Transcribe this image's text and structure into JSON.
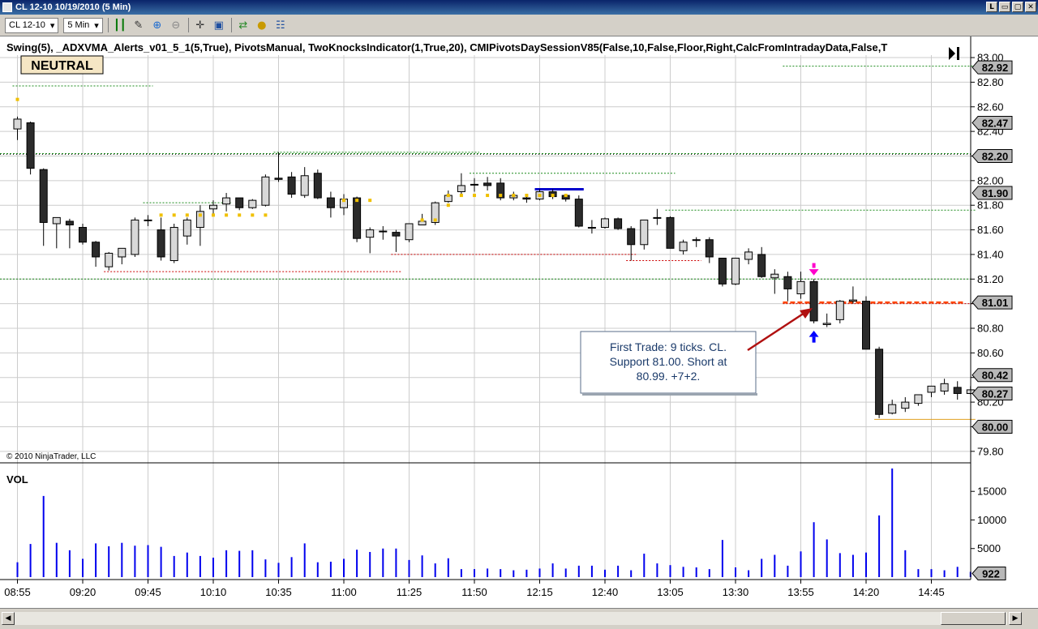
{
  "window": {
    "title": "CL 12-10  10/19/2010 (5 Min)",
    "buttons": [
      "L",
      "▭",
      "▢",
      "✕"
    ]
  },
  "toolbar": {
    "instrument": "CL 12-10",
    "interval": "5 Min"
  },
  "indicators_line": "Swing(5),  _ADXVMA_Alerts_v01_5_1(5,True),  PivotsManual,  TwoKnocksIndicator(1,True,20),  CMIPivotsDaySessionV85(False,10,False,Floor,Right,CalcFromIntradayData,False,T",
  "status_badge": "NEUTRAL",
  "copyright": "© 2010 NinjaTrader, LLC",
  "volume_label": "VOL",
  "annotation": "First Trade: 9 ticks. CL. Support 81.00. Short at 80.99. +7+2.",
  "colors": {
    "up_fill": "#d8d8d8",
    "down_fill": "#2b2b2b",
    "volume": "#0000ee",
    "grid": "#cccccc",
    "entry_line": "#ff4500",
    "arrow": "#b01010",
    "green_level": "#1a8a1a",
    "red_level": "#cc0000",
    "long_arrow": "#0000ff",
    "short_arrow": "#ff00cc"
  },
  "chart_data": {
    "type": "candlestick",
    "title": "CL 12-10  10/19/2010 (5 Min)",
    "price_axis": {
      "ylim": [
        79.7,
        83.02
      ],
      "ticks": [
        "83.00",
        "82.80",
        "82.60",
        "82.40",
        "82.20",
        "82.00",
        "81.80",
        "81.60",
        "81.40",
        "81.20",
        "81.00",
        "80.80",
        "80.60",
        "80.40",
        "80.20",
        "80.00",
        "79.80"
      ]
    },
    "price_badges": [
      {
        "label": "82.92",
        "value": 82.92
      },
      {
        "label": "82.47",
        "value": 82.47
      },
      {
        "label": "82.20",
        "value": 82.2
      },
      {
        "label": "81.90",
        "value": 81.9
      },
      {
        "label": "81.01",
        "value": 81.01
      },
      {
        "label": "80.42",
        "value": 80.42
      },
      {
        "label": "80.27",
        "value": 80.27
      },
      {
        "label": "80.00",
        "value": 80.0
      }
    ],
    "time_ticks": [
      "08:55",
      "09:20",
      "09:45",
      "10:10",
      "10:35",
      "11:00",
      "11:25",
      "11:50",
      "12:15",
      "12:40",
      "13:05",
      "13:30",
      "13:55",
      "14:20",
      "14:45"
    ],
    "bar_count": 74,
    "candles": [
      [
        82.42,
        82.52,
        82.33,
        82.5
      ],
      [
        82.47,
        82.48,
        82.05,
        82.1
      ],
      [
        82.09,
        82.1,
        81.47,
        81.66
      ],
      [
        81.65,
        81.7,
        81.45,
        81.7
      ],
      [
        81.67,
        81.69,
        81.45,
        81.64
      ],
      [
        81.62,
        81.65,
        81.48,
        81.5
      ],
      [
        81.5,
        81.51,
        81.3,
        81.38
      ],
      [
        81.3,
        81.42,
        81.27,
        81.41
      ],
      [
        81.38,
        81.45,
        81.32,
        81.45
      ],
      [
        81.4,
        81.7,
        81.38,
        81.68
      ],
      [
        81.68,
        81.72,
        81.63,
        81.68
      ],
      [
        81.6,
        81.7,
        81.35,
        81.38
      ],
      [
        81.35,
        81.65,
        81.33,
        81.62
      ],
      [
        81.55,
        81.7,
        81.48,
        81.68
      ],
      [
        81.62,
        81.8,
        81.47,
        81.75
      ],
      [
        81.77,
        81.84,
        81.73,
        81.8
      ],
      [
        81.81,
        81.9,
        81.75,
        81.86
      ],
      [
        81.86,
        81.86,
        81.76,
        81.78
      ],
      [
        81.78,
        81.85,
        81.77,
        81.84
      ],
      [
        81.8,
        82.05,
        81.79,
        82.03
      ],
      [
        82.02,
        82.23,
        81.99,
        82.01
      ],
      [
        82.03,
        82.07,
        81.86,
        81.89
      ],
      [
        81.88,
        82.11,
        81.86,
        82.04
      ],
      [
        82.06,
        82.09,
        81.85,
        81.86
      ],
      [
        81.86,
        81.91,
        81.7,
        81.78
      ],
      [
        81.78,
        81.89,
        81.72,
        81.85
      ],
      [
        81.86,
        81.87,
        81.5,
        81.53
      ],
      [
        81.54,
        81.62,
        81.41,
        81.6
      ],
      [
        81.59,
        81.63,
        81.52,
        81.59
      ],
      [
        81.58,
        81.6,
        81.42,
        81.55
      ],
      [
        81.52,
        81.65,
        81.5,
        81.65
      ],
      [
        81.64,
        81.73,
        81.64,
        81.67
      ],
      [
        81.66,
        81.83,
        81.64,
        81.82
      ],
      [
        81.83,
        81.92,
        81.82,
        81.88
      ],
      [
        81.91,
        82.06,
        81.89,
        81.96
      ],
      [
        81.97,
        82.02,
        81.91,
        81.97
      ],
      [
        81.98,
        82.03,
        81.92,
        81.96
      ],
      [
        81.98,
        82.02,
        81.84,
        81.86
      ],
      [
        81.86,
        81.91,
        81.84,
        81.88
      ],
      [
        81.86,
        81.89,
        81.82,
        81.85
      ],
      [
        81.85,
        81.93,
        81.84,
        81.91
      ],
      [
        81.91,
        81.93,
        81.85,
        81.87
      ],
      [
        81.88,
        81.89,
        81.83,
        81.85
      ],
      [
        81.85,
        81.88,
        81.62,
        81.63
      ],
      [
        81.62,
        81.68,
        81.57,
        81.62
      ],
      [
        81.62,
        81.7,
        81.61,
        81.69
      ],
      [
        81.69,
        81.7,
        81.6,
        81.61
      ],
      [
        81.61,
        81.63,
        81.35,
        81.48
      ],
      [
        81.48,
        81.68,
        81.44,
        81.68
      ],
      [
        81.7,
        81.77,
        81.64,
        81.7
      ],
      [
        81.7,
        81.71,
        81.45,
        81.45
      ],
      [
        81.43,
        81.52,
        81.4,
        81.5
      ],
      [
        81.52,
        81.54,
        81.46,
        81.52
      ],
      [
        81.52,
        81.54,
        81.33,
        81.38
      ],
      [
        81.37,
        81.37,
        81.14,
        81.16
      ],
      [
        81.16,
        81.37,
        81.15,
        81.37
      ],
      [
        81.36,
        81.45,
        81.32,
        81.42
      ],
      [
        81.4,
        81.46,
        81.21,
        81.22
      ],
      [
        81.21,
        81.28,
        81.08,
        81.24
      ],
      [
        81.22,
        81.26,
        81.02,
        81.12
      ],
      [
        81.08,
        81.26,
        81.04,
        81.18
      ],
      [
        81.18,
        81.2,
        80.84,
        80.86
      ],
      [
        80.83,
        80.92,
        80.81,
        80.84
      ],
      [
        80.87,
        81.03,
        80.84,
        81.02
      ],
      [
        81.02,
        81.14,
        81.0,
        81.03
      ],
      [
        81.02,
        81.06,
        80.69,
        80.63
      ],
      [
        80.63,
        80.65,
        80.07,
        80.1
      ],
      [
        80.11,
        80.22,
        80.1,
        80.18
      ],
      [
        80.15,
        80.24,
        80.12,
        80.2
      ],
      [
        80.19,
        80.26,
        80.17,
        80.26
      ],
      [
        80.28,
        80.33,
        80.24,
        80.33
      ],
      [
        80.29,
        80.39,
        80.26,
        80.35
      ],
      [
        80.32,
        80.37,
        80.22,
        80.27
      ],
      [
        80.27,
        80.33,
        80.26,
        80.3
      ]
    ],
    "levels": [
      {
        "value": 82.22,
        "color": "green",
        "span": "full"
      },
      {
        "value": 81.2,
        "color": "green",
        "span": "full"
      },
      {
        "value": 82.23,
        "color": "green",
        "from": 20,
        "to": 35
      },
      {
        "value": 82.06,
        "color": "green",
        "from": 35,
        "to": 50
      },
      {
        "value": 81.76,
        "color": "green",
        "from": 50,
        "to": 73
      },
      {
        "value": 81.82,
        "color": "green",
        "from": 10,
        "to": 16
      },
      {
        "value": 82.77,
        "color": "green",
        "from": 0,
        "to": 10
      },
      {
        "value": 82.93,
        "color": "green",
        "from": 59,
        "to": 73
      },
      {
        "value": 81.26,
        "color": "red",
        "from": 7,
        "to": 29
      },
      {
        "value": 81.4,
        "color": "red",
        "from": 29,
        "to": 47
      },
      {
        "value": 81.35,
        "color": "red",
        "from": 47,
        "to": 52
      },
      {
        "value": 81.0,
        "color": "red",
        "from": 59,
        "to": 73
      },
      {
        "value": 80.06,
        "color": "orange",
        "from": 66,
        "to": 73
      }
    ],
    "entry_level": 81.01,
    "volume_axis": {
      "ylim": [
        0,
        19000
      ],
      "ticks": [
        "15000",
        "10000",
        "5000"
      ]
    },
    "volume_last_label": "922",
    "volume": [
      2600,
      5800,
      14200,
      6000,
      4700,
      3200,
      5900,
      5400,
      6000,
      5500,
      5600,
      5300,
      3700,
      4300,
      3700,
      3400,
      4700,
      4600,
      4700,
      3100,
      2500,
      3500,
      5900,
      2600,
      2700,
      3200,
      4800,
      4400,
      5000,
      5000,
      3000,
      3800,
      2400,
      3300,
      1400,
      1400,
      1500,
      1400,
      1200,
      1300,
      1500,
      2400,
      1500,
      2000,
      2000,
      1300,
      2000,
      1200,
      4100,
      2400,
      2100,
      1800,
      1700,
      1400,
      6500,
      1700,
      1200,
      3200,
      3900,
      2000,
      4500,
      9600,
      6600,
      4200,
      3900,
      4300,
      10800,
      19000,
      4700,
      1400,
      1400,
      1200,
      1800,
      922
    ]
  }
}
